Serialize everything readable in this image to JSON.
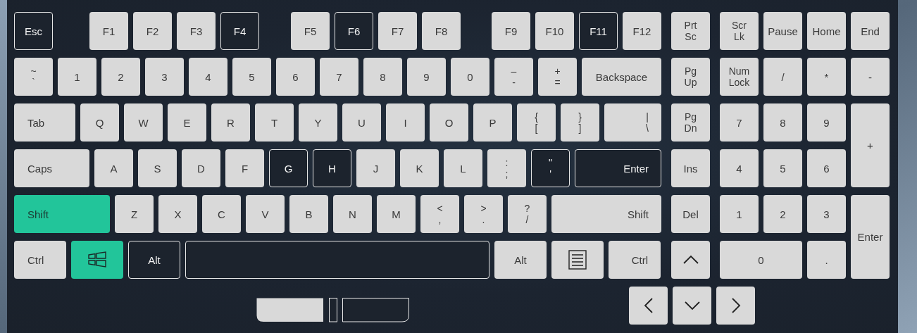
{
  "keyboard": {
    "rows": [
      {
        "keys": [
          {
            "legends": [
              "Esc"
            ],
            "tested": true,
            "pressed": false
          },
          {
            "legends": [
              "F1"
            ],
            "tested": false,
            "pressed": false
          },
          {
            "legends": [
              "F2"
            ],
            "tested": false,
            "pressed": false
          },
          {
            "legends": [
              "F3"
            ],
            "tested": false,
            "pressed": false
          },
          {
            "legends": [
              "F4"
            ],
            "tested": true,
            "pressed": false
          },
          {
            "legends": [
              "F5"
            ],
            "tested": false,
            "pressed": false
          },
          {
            "legends": [
              "F6"
            ],
            "tested": true,
            "pressed": false
          },
          {
            "legends": [
              "F7"
            ],
            "tested": false,
            "pressed": false
          },
          {
            "legends": [
              "F8"
            ],
            "tested": false,
            "pressed": false
          },
          {
            "legends": [
              "F9"
            ],
            "tested": false,
            "pressed": false
          },
          {
            "legends": [
              "F10"
            ],
            "tested": false,
            "pressed": false
          },
          {
            "legends": [
              "F11"
            ],
            "tested": true,
            "pressed": false
          },
          {
            "legends": [
              "F12"
            ],
            "tested": false,
            "pressed": false
          }
        ]
      },
      {
        "keys": [
          {
            "legends": [
              "~",
              "`"
            ],
            "tested": false,
            "pressed": false
          },
          {
            "legends": [
              "1"
            ],
            "tested": false,
            "pressed": false
          },
          {
            "legends": [
              "2"
            ],
            "tested": false,
            "pressed": false
          },
          {
            "legends": [
              "3"
            ],
            "tested": false,
            "pressed": false
          },
          {
            "legends": [
              "4"
            ],
            "tested": false,
            "pressed": false
          },
          {
            "legends": [
              "5"
            ],
            "tested": false,
            "pressed": false
          },
          {
            "legends": [
              "6"
            ],
            "tested": false,
            "pressed": false
          },
          {
            "legends": [
              "7"
            ],
            "tested": false,
            "pressed": false
          },
          {
            "legends": [
              "8"
            ],
            "tested": false,
            "pressed": false
          },
          {
            "legends": [
              "9"
            ],
            "tested": false,
            "pressed": false
          },
          {
            "legends": [
              "0"
            ],
            "tested": false,
            "pressed": false
          },
          {
            "legends": [
              "–",
              "-"
            ],
            "tested": false,
            "pressed": false
          },
          {
            "legends": [
              "+",
              "="
            ],
            "tested": false,
            "pressed": false
          },
          {
            "legends": [
              "Backspace"
            ],
            "tested": false,
            "pressed": false
          }
        ]
      },
      {
        "keys": [
          {
            "legends": [
              "Tab"
            ],
            "tested": false,
            "pressed": false
          },
          {
            "legends": [
              "Q"
            ],
            "tested": false,
            "pressed": false
          },
          {
            "legends": [
              "W"
            ],
            "tested": false,
            "pressed": false
          },
          {
            "legends": [
              "E"
            ],
            "tested": false,
            "pressed": false
          },
          {
            "legends": [
              "R"
            ],
            "tested": false,
            "pressed": false
          },
          {
            "legends": [
              "T"
            ],
            "tested": false,
            "pressed": false
          },
          {
            "legends": [
              "Y"
            ],
            "tested": false,
            "pressed": false
          },
          {
            "legends": [
              "U"
            ],
            "tested": false,
            "pressed": false
          },
          {
            "legends": [
              "I"
            ],
            "tested": false,
            "pressed": false
          },
          {
            "legends": [
              "O"
            ],
            "tested": false,
            "pressed": false
          },
          {
            "legends": [
              "P"
            ],
            "tested": false,
            "pressed": false
          },
          {
            "legends": [
              "{",
              "["
            ],
            "tested": false,
            "pressed": false
          },
          {
            "legends": [
              "}",
              "]"
            ],
            "tested": false,
            "pressed": false
          },
          {
            "legends": [
              "|",
              "\\"
            ],
            "tested": false,
            "pressed": false
          }
        ]
      },
      {
        "keys": [
          {
            "legends": [
              "Caps"
            ],
            "tested": false,
            "pressed": false
          },
          {
            "legends": [
              "A"
            ],
            "tested": false,
            "pressed": false
          },
          {
            "legends": [
              "S"
            ],
            "tested": false,
            "pressed": false
          },
          {
            "legends": [
              "D"
            ],
            "tested": false,
            "pressed": false
          },
          {
            "legends": [
              "F"
            ],
            "tested": false,
            "pressed": false
          },
          {
            "legends": [
              "G"
            ],
            "tested": true,
            "pressed": false
          },
          {
            "legends": [
              "H"
            ],
            "tested": true,
            "pressed": false
          },
          {
            "legends": [
              "J"
            ],
            "tested": false,
            "pressed": false
          },
          {
            "legends": [
              "K"
            ],
            "tested": false,
            "pressed": false
          },
          {
            "legends": [
              "L"
            ],
            "tested": false,
            "pressed": false
          },
          {
            "legends": [
              ":",
              ";"
            ],
            "tested": false,
            "pressed": false
          },
          {
            "legends": [
              "\"",
              "'"
            ],
            "tested": true,
            "pressed": false
          },
          {
            "legends": [
              "Enter"
            ],
            "tested": true,
            "pressed": false
          }
        ]
      },
      {
        "keys": [
          {
            "legends": [
              "Shift"
            ],
            "tested": false,
            "pressed": true
          },
          {
            "legends": [
              "Z"
            ],
            "tested": false,
            "pressed": false
          },
          {
            "legends": [
              "X"
            ],
            "tested": false,
            "pressed": false
          },
          {
            "legends": [
              "C"
            ],
            "tested": false,
            "pressed": false
          },
          {
            "legends": [
              "V"
            ],
            "tested": false,
            "pressed": false
          },
          {
            "legends": [
              "B"
            ],
            "tested": false,
            "pressed": false
          },
          {
            "legends": [
              "N"
            ],
            "tested": false,
            "pressed": false
          },
          {
            "legends": [
              "M"
            ],
            "tested": false,
            "pressed": false
          },
          {
            "legends": [
              "<",
              ","
            ],
            "tested": false,
            "pressed": false
          },
          {
            "legends": [
              ">",
              "."
            ],
            "tested": false,
            "pressed": false
          },
          {
            "legends": [
              "?",
              "/"
            ],
            "tested": false,
            "pressed": false
          },
          {
            "legends": [
              "Shift"
            ],
            "tested": false,
            "pressed": false
          }
        ]
      },
      {
        "keys": [
          {
            "legends": [
              "Ctrl"
            ],
            "tested": false,
            "pressed": false
          },
          {
            "kind": "windows",
            "tested": false,
            "pressed": true
          },
          {
            "legends": [
              "Alt"
            ],
            "tested": true,
            "pressed": false
          },
          {
            "kind": "space",
            "tested": true,
            "pressed": false
          },
          {
            "legends": [
              "Alt"
            ],
            "tested": false,
            "pressed": false
          },
          {
            "kind": "menu",
            "tested": false,
            "pressed": false
          },
          {
            "legends": [
              "Ctrl"
            ],
            "tested": false,
            "pressed": false
          }
        ]
      }
    ],
    "nav": [
      {
        "legends": [
          "Prt",
          "Sc"
        ],
        "tested": false,
        "pressed": false
      },
      {
        "legends": [
          "Pg",
          "Up"
        ],
        "tested": false,
        "pressed": false
      },
      {
        "legends": [
          "Pg",
          "Dn"
        ],
        "tested": false,
        "pressed": false
      },
      {
        "legends": [
          "Ins"
        ],
        "tested": false,
        "pressed": false
      },
      {
        "legends": [
          "Del"
        ],
        "tested": false,
        "pressed": false
      },
      {
        "kind": "up",
        "tested": false,
        "pressed": false
      }
    ],
    "numpad": [
      {
        "legends": [
          "Scr",
          "Lk"
        ],
        "tested": false,
        "pressed": false
      },
      {
        "legends": [
          "Pause"
        ],
        "tested": false,
        "pressed": false
      },
      {
        "legends": [
          "Home"
        ],
        "tested": false,
        "pressed": false
      },
      {
        "legends": [
          "End"
        ],
        "tested": false,
        "pressed": false
      },
      {
        "legends": [
          "Num",
          "Lock"
        ],
        "tested": false,
        "pressed": false
      },
      {
        "legends": [
          "/"
        ],
        "tested": false,
        "pressed": false
      },
      {
        "legends": [
          "*"
        ],
        "tested": false,
        "pressed": false
      },
      {
        "legends": [
          "-"
        ],
        "tested": false,
        "pressed": false
      },
      {
        "legends": [
          "7"
        ],
        "tested": false,
        "pressed": false
      },
      {
        "legends": [
          "8"
        ],
        "tested": false,
        "pressed": false
      },
      {
        "legends": [
          "9"
        ],
        "tested": false,
        "pressed": false
      },
      {
        "legends": [
          "+"
        ],
        "tested": false,
        "pressed": false
      },
      {
        "legends": [
          "4"
        ],
        "tested": false,
        "pressed": false
      },
      {
        "legends": [
          "5"
        ],
        "tested": false,
        "pressed": false
      },
      {
        "legends": [
          "6"
        ],
        "tested": false,
        "pressed": false
      },
      {
        "legends": [
          "1"
        ],
        "tested": false,
        "pressed": false
      },
      {
        "legends": [
          "2"
        ],
        "tested": false,
        "pressed": false
      },
      {
        "legends": [
          "3"
        ],
        "tested": false,
        "pressed": false
      },
      {
        "legends": [
          "Enter"
        ],
        "tested": false,
        "pressed": false
      },
      {
        "legends": [
          "0"
        ],
        "tested": false,
        "pressed": false
      },
      {
        "legends": [
          "."
        ],
        "tested": false,
        "pressed": false
      }
    ],
    "arrows": [
      {
        "kind": "left",
        "tested": false,
        "pressed": false
      },
      {
        "kind": "down",
        "tested": false,
        "pressed": false
      },
      {
        "kind": "right",
        "tested": false,
        "pressed": false
      }
    ]
  },
  "mouse": {
    "buttons": [
      {
        "tested": false,
        "pressed": false
      },
      {
        "tested": true,
        "pressed": false
      },
      {
        "tested": true,
        "pressed": false
      }
    ]
  }
}
